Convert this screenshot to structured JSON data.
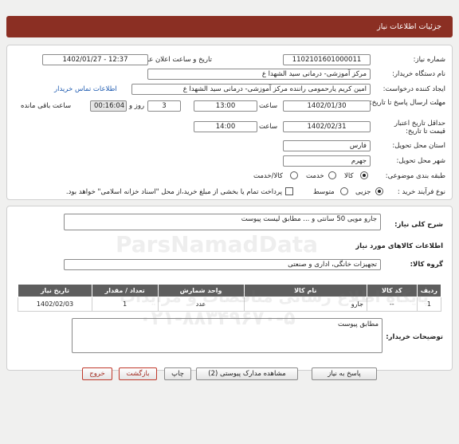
{
  "header": {
    "title": "جزئیات اطلاعات نیاز"
  },
  "form": {
    "need_number_label": "شماره نیاز:",
    "need_number": "1102101601000011",
    "announce_label": "تاریخ و ساعت اعلان عمومی:",
    "announce_value": "1402/01/27 - 12:37",
    "buyer_org_label": "نام دستگاه خریدار:",
    "buyer_org": "مرکز آموزشی- درمانی سید الشهدا ع",
    "creator_label": "ایجاد کننده درخواست:",
    "creator": "امین کریم یارحمومی راننده مرکز آموزشی- درمانی سید الشهدا ع",
    "contact_link": "اطلاعات تماس خریدار",
    "deadline_label": "مهلت ارسال پاسخ تا تاریخ:",
    "deadline_date": "1402/01/30",
    "time_label": "ساعت",
    "deadline_time": "13:00",
    "days_value": "3",
    "days_label": "روز و",
    "remaining_time": "00:16:04",
    "remaining_label": "ساعت باقی مانده",
    "min_validity_label": "حداقل تاریخ اعتبار قیمت تا تاریخ:",
    "validity_date": "1402/02/31",
    "validity_time_label": "ساعت",
    "validity_time": "14:00",
    "province_label": "استان محل تحویل:",
    "province": "فارس",
    "city_label": "شهر محل تحویل:",
    "city": "جهرم",
    "category_label": "طبقه بندی موضوعی:",
    "category_options": [
      "کالا",
      "خدمت",
      "کالا/خدمت"
    ],
    "process_label": "نوع فرآیند خرید :",
    "process_options": [
      "جزیی",
      "متوسط"
    ],
    "payment_note": "پرداخت تمام یا بخشی از مبلغ خرید،از محل \"اسناد خزانه اسلامی\" خواهد بود."
  },
  "details": {
    "summary_label": "شرح کلی نیاز:",
    "summary": "جارو مویی 50 سانتی و ... مطابق لیست پیوست",
    "goods_heading": "اطلاعات کالاهای مورد نیاز",
    "group_label": "گروه کالا:",
    "group_value": "تجهیزات خانگی، اداری و صنعتی",
    "table": {
      "headers": [
        "ردیف",
        "کد کالا",
        "نام کالا",
        "واحد شمارش",
        "تعداد / مقدار",
        "تاریخ نیاز"
      ],
      "rows": [
        [
          "1",
          "--",
          "جارو",
          "عدد",
          "1",
          "1402/02/03"
        ]
      ]
    },
    "buyer_notes_label": "توضیحات خریدار:",
    "buyer_notes": "مطابق پیوست"
  },
  "buttons": {
    "reply": "پاسخ به نیاز",
    "attachments": "مشاهده مدارک پیوستی (2)",
    "print": "چاپ",
    "back": "بازگشت",
    "exit": "خروج"
  },
  "watermark": {
    "brand": "ParsNamadData",
    "phone": "۰۲۱-۸۸۳۴۹۶۷۰-۵",
    "tagline": "پایگاه اطلاع رسانی مناقصات و مزایدات"
  },
  "colors": {
    "header_bg": "#8b2f23",
    "link": "#1d5ab0",
    "table_header": "#5e5e5e"
  }
}
